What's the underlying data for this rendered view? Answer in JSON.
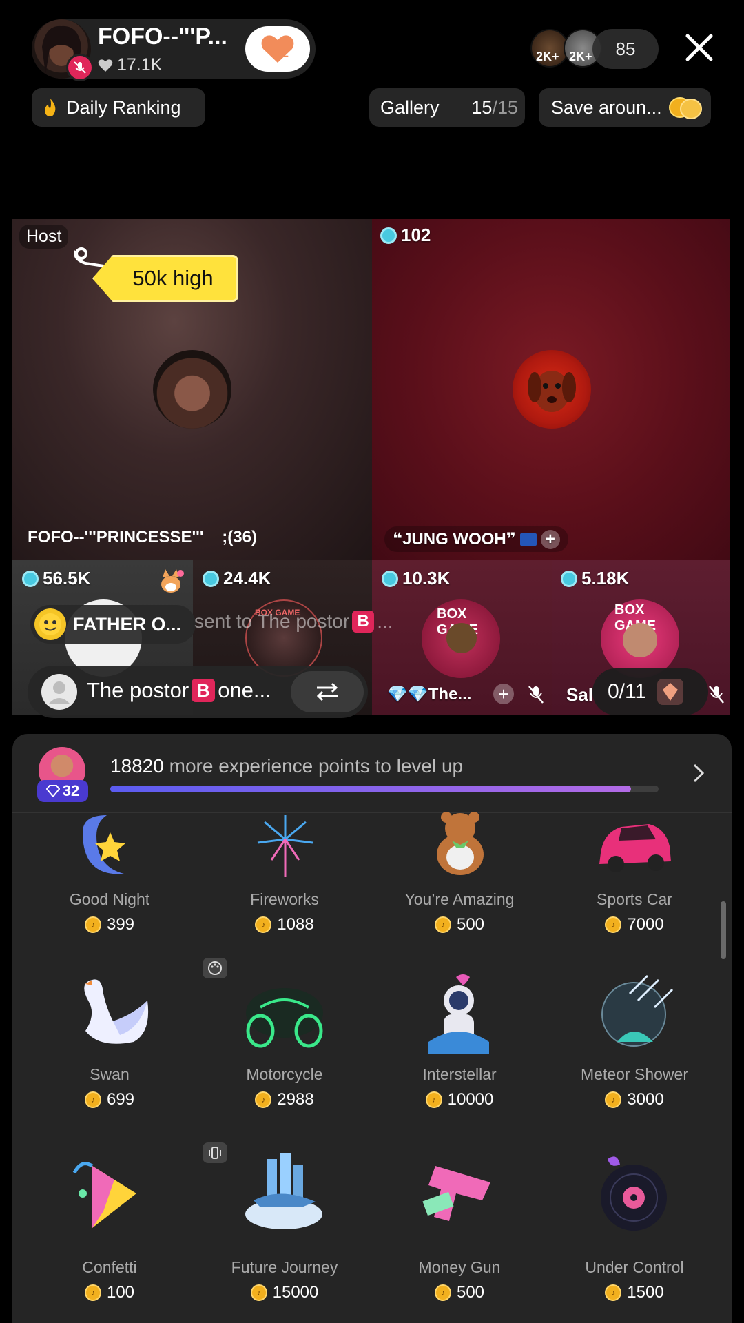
{
  "header": {
    "host_name": "FOFO--'''P...",
    "likes": "17.1K",
    "follow_badge_count": "2",
    "viewer_count": "85",
    "viewer_avatar_labels": [
      "2K+",
      "2K+"
    ]
  },
  "chips": {
    "daily_ranking": "Daily Ranking",
    "gallery_label": "Gallery",
    "gallery_current": "15",
    "gallery_total": "/15",
    "save_around": "Save aroun..."
  },
  "battle": {
    "host_tag": "Host",
    "high_tag": "50k high",
    "host_full_name": "FOFO--'''PRINCESSE'''__;(36)",
    "opponent_score": "102",
    "opponent_name": "❝JUNG WOOH❞",
    "guests": [
      {
        "score": "56.5K"
      },
      {
        "score": "24.4K"
      },
      {
        "score": "10.3K",
        "name": "💎💎The..."
      },
      {
        "score": "5.18K",
        "name": "Sal"
      }
    ],
    "father_name": "FATHER O...",
    "sent_text": "sent to The postor",
    "sent_suffix": "...",
    "postor_label": "The postor",
    "postor_suffix": "one...",
    "b_letter": "B",
    "seat_count": "0/11",
    "box_game": "BOX GAME"
  },
  "level": {
    "points": "18820",
    "text": "more experience points to level up",
    "level": "32",
    "progress": 0.95
  },
  "gifts": [
    {
      "name": "Good Night",
      "price": "399"
    },
    {
      "name": "Fireworks",
      "price": "1088"
    },
    {
      "name": "You’re Amazing",
      "price": "500"
    },
    {
      "name": "Sports Car",
      "price": "7000"
    },
    {
      "name": "Swan",
      "price": "699"
    },
    {
      "name": "Motorcycle",
      "price": "2988"
    },
    {
      "name": "Interstellar",
      "price": "10000"
    },
    {
      "name": "Meteor Shower",
      "price": "3000"
    },
    {
      "name": "Confetti",
      "price": "100"
    },
    {
      "name": "Future Journey",
      "price": "15000"
    },
    {
      "name": "Money Gun",
      "price": "500"
    },
    {
      "name": "Under Control",
      "price": "1500"
    }
  ],
  "colors": {
    "accent_red": "#e0265a",
    "progress_start": "#5b5cf0",
    "progress_end": "#b36be6",
    "coin": "#f2b01e",
    "gem": "#48c9e0"
  }
}
